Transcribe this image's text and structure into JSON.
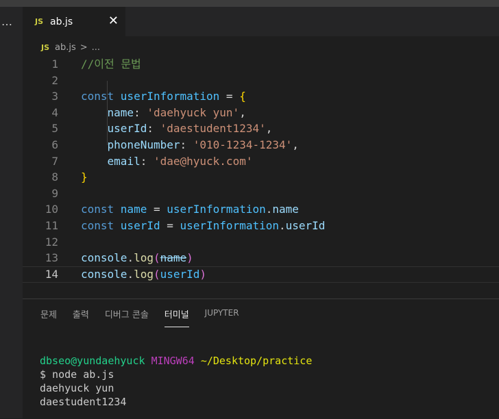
{
  "window": {
    "more_icon": "…"
  },
  "tab": {
    "badge": "JS",
    "label": "ab.js",
    "close": "✕"
  },
  "breadcrumb": {
    "badge": "JS",
    "file": "ab.js",
    "separator": ">",
    "rest": "..."
  },
  "editor": {
    "current_line": 14,
    "lines": [
      {
        "n": "1",
        "tokens": [
          {
            "t": "//이전 문법",
            "c": "comment"
          }
        ]
      },
      {
        "n": "2",
        "tokens": []
      },
      {
        "n": "3",
        "tokens": [
          {
            "t": "const ",
            "c": "kw"
          },
          {
            "t": "userInformation",
            "c": "const"
          },
          {
            "t": " = ",
            "c": "op"
          },
          {
            "t": "{",
            "c": "brace"
          }
        ]
      },
      {
        "n": "4",
        "tokens": [
          {
            "t": "    name",
            "c": "var"
          },
          {
            "t": ": ",
            "c": "op"
          },
          {
            "t": "'daehyuck yun'",
            "c": "str"
          },
          {
            "t": ",",
            "c": "op"
          }
        ]
      },
      {
        "n": "5",
        "tokens": [
          {
            "t": "    userId",
            "c": "var"
          },
          {
            "t": ": ",
            "c": "op"
          },
          {
            "t": "'daestudent1234'",
            "c": "str"
          },
          {
            "t": ",",
            "c": "op"
          }
        ]
      },
      {
        "n": "6",
        "tokens": [
          {
            "t": "    phoneNumber",
            "c": "var"
          },
          {
            "t": ": ",
            "c": "op"
          },
          {
            "t": "'010-1234-1234'",
            "c": "str"
          },
          {
            "t": ",",
            "c": "op"
          }
        ]
      },
      {
        "n": "7",
        "tokens": [
          {
            "t": "    email",
            "c": "var"
          },
          {
            "t": ": ",
            "c": "op"
          },
          {
            "t": "'dae@hyuck.com'",
            "c": "str"
          }
        ]
      },
      {
        "n": "8",
        "tokens": [
          {
            "t": "}",
            "c": "brace"
          }
        ]
      },
      {
        "n": "9",
        "tokens": []
      },
      {
        "n": "10",
        "tokens": [
          {
            "t": "const ",
            "c": "kw"
          },
          {
            "t": "name",
            "c": "const"
          },
          {
            "t": " = ",
            "c": "op"
          },
          {
            "t": "userInformation",
            "c": "const"
          },
          {
            "t": ".",
            "c": "op"
          },
          {
            "t": "name",
            "c": "var"
          }
        ]
      },
      {
        "n": "11",
        "tokens": [
          {
            "t": "const ",
            "c": "kw"
          },
          {
            "t": "userId",
            "c": "const"
          },
          {
            "t": " = ",
            "c": "op"
          },
          {
            "t": "userInformation",
            "c": "const"
          },
          {
            "t": ".",
            "c": "op"
          },
          {
            "t": "userId",
            "c": "var"
          }
        ]
      },
      {
        "n": "12",
        "tokens": []
      },
      {
        "n": "13",
        "tokens": [
          {
            "t": "console",
            "c": "var"
          },
          {
            "t": ".",
            "c": "op"
          },
          {
            "t": "log",
            "c": "fn"
          },
          {
            "t": "(",
            "c": "paren"
          },
          {
            "t": "name",
            "c": "var-strike"
          },
          {
            "t": ")",
            "c": "paren"
          }
        ]
      },
      {
        "n": "14",
        "tokens": [
          {
            "t": "console",
            "c": "var"
          },
          {
            "t": ".",
            "c": "op"
          },
          {
            "t": "log",
            "c": "fn"
          },
          {
            "t": "(",
            "c": "paren"
          },
          {
            "t": "userId",
            "c": "const"
          },
          {
            "t": ")",
            "c": "paren"
          }
        ]
      }
    ]
  },
  "panel": {
    "tabs": [
      {
        "label": "문제",
        "active": false
      },
      {
        "label": "출력",
        "active": false
      },
      {
        "label": "디버그 콘솔",
        "active": false
      },
      {
        "label": "터미널",
        "active": true
      },
      {
        "label": "JUPYTER",
        "active": false
      }
    ]
  },
  "terminal": {
    "prompt_user": "dbseo@yundaehyuck",
    "prompt_env": "MINGW64",
    "prompt_path": "~/Desktop/practice",
    "command": "$ node ab.js",
    "output": [
      "daehyuck yun",
      "daestudent1234"
    ]
  },
  "colors": {
    "background": "#1e1e1e",
    "comment": "#6a9955",
    "keyword": "#569cd6",
    "string": "#ce9178",
    "function": "#dcdcaa",
    "brace": "#ffd700",
    "terminal_green": "#23d18b",
    "terminal_purple": "#bc3fbc",
    "terminal_yellow": "#e5e510"
  }
}
